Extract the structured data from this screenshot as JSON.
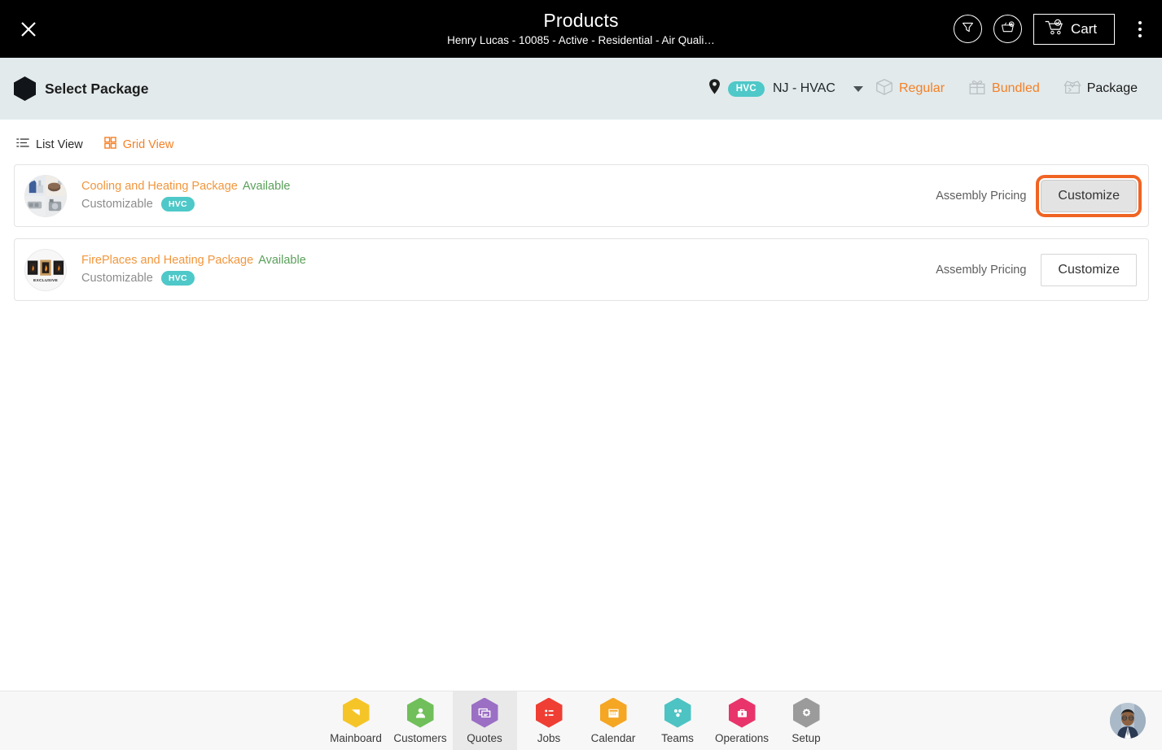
{
  "header": {
    "close_icon": "close-icon",
    "title": "Products",
    "subtitle": "Henry Lucas - 10085 - Active - Residential - Air Quali…",
    "filter_icon": "filter-funnel-icon",
    "basket_icon": "add-to-basket-icon",
    "cart_label": "Cart",
    "cart_icon": "shopping-cart-icon",
    "more_icon": "kebab-menu-icon"
  },
  "subheader": {
    "hex_icon": "hexagon-icon",
    "title": "Select Package",
    "location_icon": "location-pin-icon",
    "location_badge": "HVC",
    "location_value": "NJ - HVAC",
    "chevron_icon": "chevron-down-icon",
    "type_tabs": [
      {
        "label": "Regular",
        "icon": "box-3d-icon",
        "active": false
      },
      {
        "label": "Bundled",
        "icon": "gift-box-icon",
        "active": false
      },
      {
        "label": "Package",
        "icon": "open-package-icon",
        "active": true
      }
    ]
  },
  "view_toggle": [
    {
      "label": "List View",
      "icon": "list-view-icon",
      "active": true
    },
    {
      "label": "Grid View",
      "icon": "grid-view-icon",
      "active": false
    }
  ],
  "products": [
    {
      "thumbnail": "hvac-equipment-collage-thumbnail",
      "title": "Cooling and Heating Package",
      "availability": "Available",
      "customizable": "Customizable",
      "badge": "HVC",
      "pricing_label": "Assembly Pricing",
      "action_label": "Customize",
      "action_highlighted": true
    },
    {
      "thumbnail": "fireplaces-exclusive-thumbnail",
      "title": "FirePlaces and Heating Package",
      "availability": "Available",
      "customizable": "Customizable",
      "badge": "HVC",
      "pricing_label": "Assembly Pricing",
      "action_label": "Customize",
      "action_highlighted": false
    }
  ],
  "bottom_nav": {
    "items": [
      {
        "label": "Mainboard",
        "icon": "mainboard-icon",
        "color": "#f5c528",
        "active": false
      },
      {
        "label": "Customers",
        "icon": "customers-icon",
        "color": "#70bf5a",
        "active": false
      },
      {
        "label": "Quotes",
        "icon": "quotes-icon",
        "color": "#9b6fc4",
        "active": true
      },
      {
        "label": "Jobs",
        "icon": "jobs-icon",
        "color": "#ef3e33",
        "active": false
      },
      {
        "label": "Calendar",
        "icon": "calendar-icon",
        "color": "#f5a623",
        "active": false
      },
      {
        "label": "Teams",
        "icon": "teams-icon",
        "color": "#4ec3c3",
        "active": false
      },
      {
        "label": "Operations",
        "icon": "operations-icon",
        "color": "#e8346a",
        "active": false
      },
      {
        "label": "Setup",
        "icon": "setup-icon",
        "color": "#9b9b9b",
        "active": false
      }
    ],
    "avatar": "user-avatar"
  },
  "colors": {
    "header_bg": "#000000",
    "subheader_bg": "#e2eaec",
    "accent_orange": "#f58025",
    "teal_badge": "#4ec8c8",
    "available_green": "#5aa05a",
    "highlight_ring": "#f06423"
  }
}
